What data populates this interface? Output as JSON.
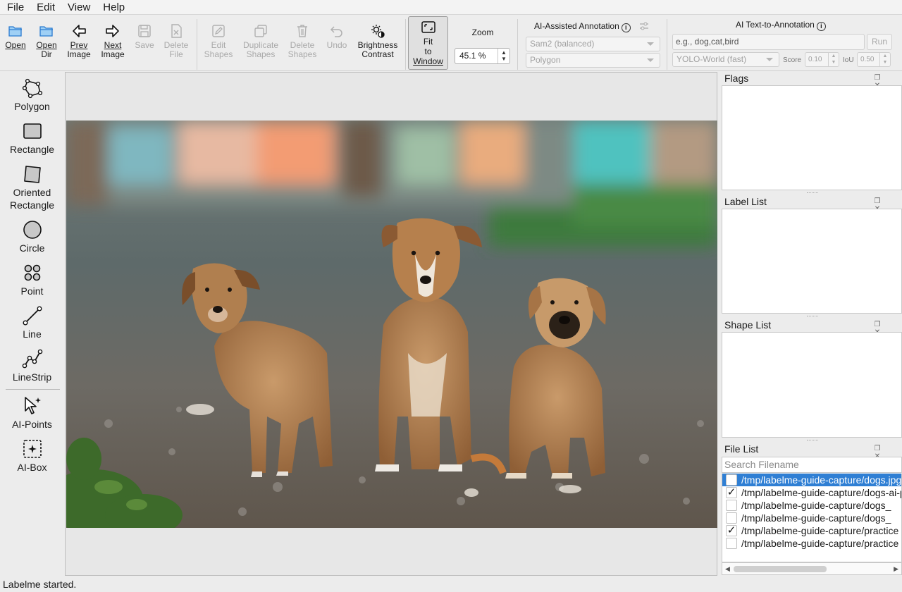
{
  "menu": [
    "File",
    "Edit",
    "View",
    "Help"
  ],
  "toolbar": {
    "open": {
      "l1": "Open"
    },
    "open_dir": {
      "l1": "Open",
      "l2": "Dir"
    },
    "prev": {
      "l1": "Prev",
      "l2": "Image"
    },
    "next": {
      "l1": "Next",
      "l2": "Image"
    },
    "save": {
      "l1": "Save"
    },
    "delete_file": {
      "l1": "Delete",
      "l2": "File"
    },
    "edit_shapes": {
      "l1": "Edit",
      "l2": "Shapes"
    },
    "duplicate_shapes": {
      "l1": "Duplicate",
      "l2": "Shapes"
    },
    "delete_shapes": {
      "l1": "Delete",
      "l2": "Shapes"
    },
    "undo": {
      "l1": "Undo"
    },
    "brightness": {
      "l1": "Brightness",
      "l2": "Contrast"
    },
    "fit": {
      "l1": "Fit",
      "l2": "to",
      "l3": "Window"
    },
    "zoom_label": "Zoom",
    "zoom_value": "45.1 %"
  },
  "ai_assisted": {
    "title": "AI-Assisted Annotation",
    "model": "Sam2 (balanced)",
    "shape": "Polygon"
  },
  "ai_text": {
    "title": "AI Text-to-Annotation",
    "placeholder": "e.g., dog,cat,bird",
    "run": "Run",
    "model": "YOLO-World (fast)",
    "score_label": "Score",
    "score_value": "0.10",
    "iou_label": "IoU",
    "iou_value": "0.50"
  },
  "tools": [
    "Polygon",
    "Rectangle",
    "Oriented",
    "Rectangle",
    "Circle",
    "Point",
    "Line",
    "LineStrip",
    "AI-Points",
    "AI-Box"
  ],
  "docks": {
    "flags": "Flags",
    "labels": "Label List",
    "shapes": "Shape List",
    "files": "File List",
    "search_placeholder": "Search Filename"
  },
  "files": [
    {
      "name": "/tmp/labelme-guide-capture/dogs.jpg",
      "checked": "",
      "selected": true
    },
    {
      "name": "/tmp/labelme-guide-capture/dogs-ai-points.jpg",
      "checked": "✓",
      "selected": false
    },
    {
      "name": "/tmp/labelme-guide-capture/dogs_",
      "checked": "",
      "selected": false
    },
    {
      "name": "/tmp/labelme-guide-capture/dogs_",
      "checked": "",
      "selected": false
    },
    {
      "name": "/tmp/labelme-guide-capture/practice",
      "checked": "✓",
      "selected": false
    },
    {
      "name": "/tmp/labelme-guide-capture/practice",
      "checked": "",
      "selected": false
    }
  ],
  "status": "Labelme started."
}
